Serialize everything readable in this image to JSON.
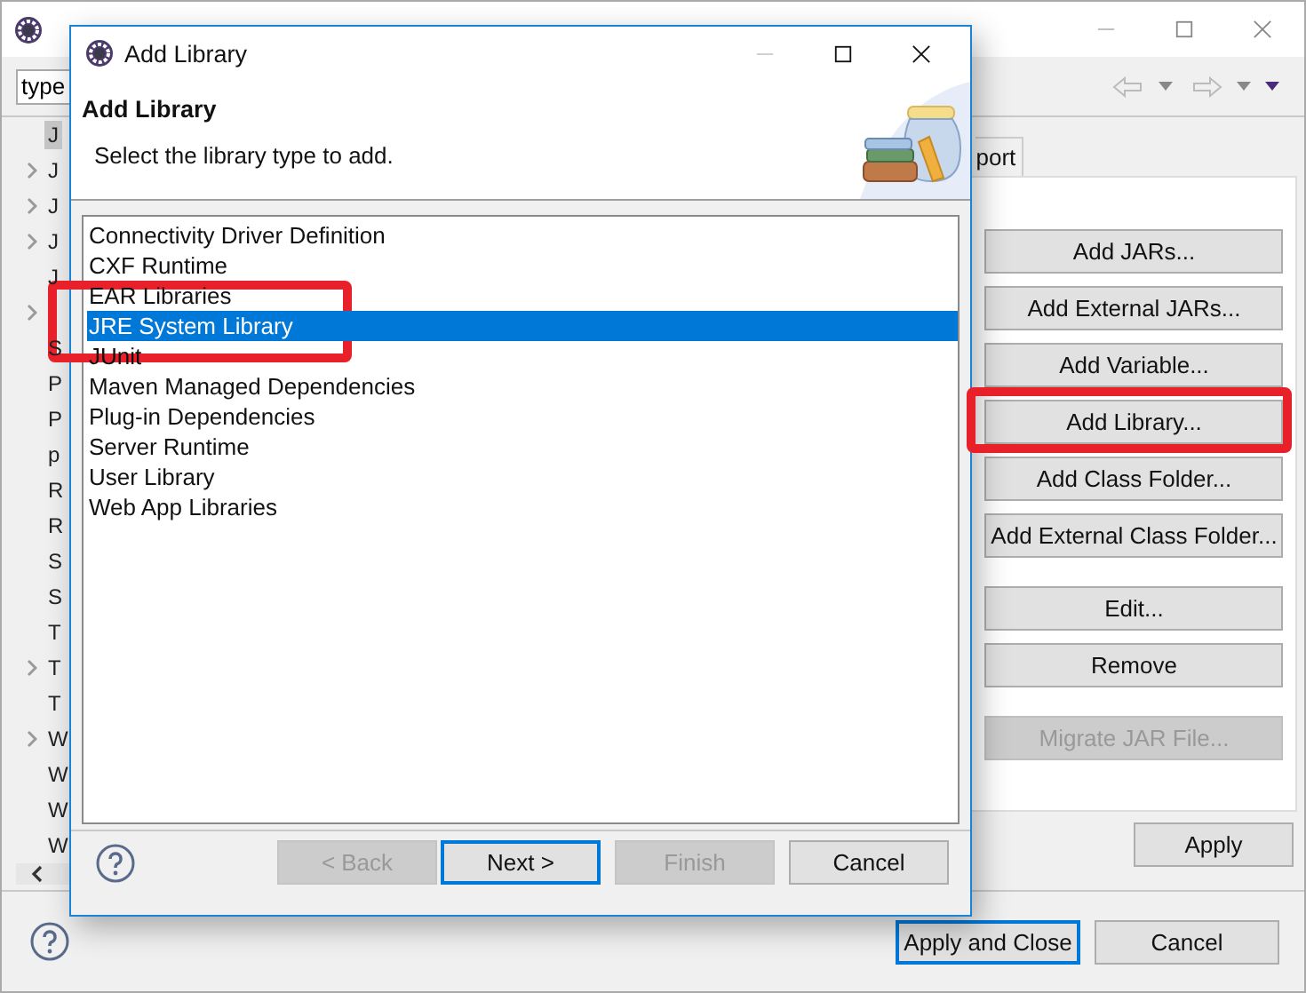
{
  "background_window": {
    "filter": {
      "value": "type"
    },
    "tree": [
      {
        "label": "J",
        "selected": true,
        "expandable": false
      },
      {
        "label": "J",
        "selected": false,
        "expandable": true
      },
      {
        "label": "J",
        "selected": false,
        "expandable": true
      },
      {
        "label": "J",
        "selected": false,
        "expandable": true
      },
      {
        "label": "J",
        "selected": false,
        "expandable": false
      },
      {
        "selected": false,
        "expandable": true
      },
      {
        "label": "S",
        "selected": false,
        "expandable": false
      },
      {
        "label": "P",
        "selected": false,
        "expandable": false
      },
      {
        "label": "P",
        "selected": false,
        "expandable": false
      },
      {
        "label": "p",
        "selected": false,
        "expandable": false
      },
      {
        "label": "R",
        "selected": false,
        "expandable": false
      },
      {
        "label": "R",
        "selected": false,
        "expandable": false
      },
      {
        "label": "S",
        "selected": false,
        "expandable": false
      },
      {
        "label": "S",
        "selected": false,
        "expandable": false
      },
      {
        "label": "T",
        "selected": false,
        "expandable": false
      },
      {
        "label": "T",
        "selected": false,
        "expandable": true
      },
      {
        "label": "T",
        "selected": false,
        "expandable": false
      },
      {
        "label": "W",
        "selected": false,
        "expandable": true
      },
      {
        "label": "W",
        "selected": false,
        "expandable": false
      },
      {
        "label": "W",
        "selected": false,
        "expandable": false
      },
      {
        "label": "W",
        "selected": false,
        "expandable": false
      }
    ],
    "tab": {
      "label": "port"
    },
    "buttons": [
      {
        "label": "Add JARs...",
        "disabled": false
      },
      {
        "label": "Add External JARs...",
        "disabled": false
      },
      {
        "label": "Add Variable...",
        "disabled": false
      },
      {
        "label": "Add Library...",
        "disabled": false
      },
      {
        "label": "Add Class Folder...",
        "disabled": false
      },
      {
        "label": "Add External Class Folder...",
        "disabled": false
      },
      {
        "label": "Edit...",
        "disabled": false
      },
      {
        "label": "Remove",
        "disabled": false
      },
      {
        "label": "Migrate JAR File...",
        "disabled": true
      }
    ],
    "apply": "Apply",
    "footer_buttons": [
      {
        "label": "Apply and Close",
        "default": true
      },
      {
        "label": "Cancel",
        "default": false
      }
    ]
  },
  "dialog": {
    "title": "Add Library",
    "heading": "Add Library",
    "description": "Select the library type to add.",
    "items": [
      {
        "label": "Connectivity Driver Definition",
        "selected": false
      },
      {
        "label": "CXF Runtime",
        "selected": false
      },
      {
        "label": "EAR Libraries",
        "selected": false
      },
      {
        "label": "JRE System Library",
        "selected": true
      },
      {
        "label": "JUnit",
        "selected": false
      },
      {
        "label": "Maven Managed Dependencies",
        "selected": false
      },
      {
        "label": "Plug-in Dependencies",
        "selected": false
      },
      {
        "label": "Server Runtime",
        "selected": false
      },
      {
        "label": "User Library",
        "selected": false
      },
      {
        "label": "Web App Libraries",
        "selected": false
      }
    ],
    "buttons": [
      {
        "label": "< Back",
        "disabled": true,
        "default": false
      },
      {
        "label": "Next >",
        "disabled": false,
        "default": true
      },
      {
        "label": "Finish",
        "disabled": true,
        "default": false
      },
      {
        "label": "Cancel",
        "disabled": false,
        "default": false
      }
    ]
  }
}
